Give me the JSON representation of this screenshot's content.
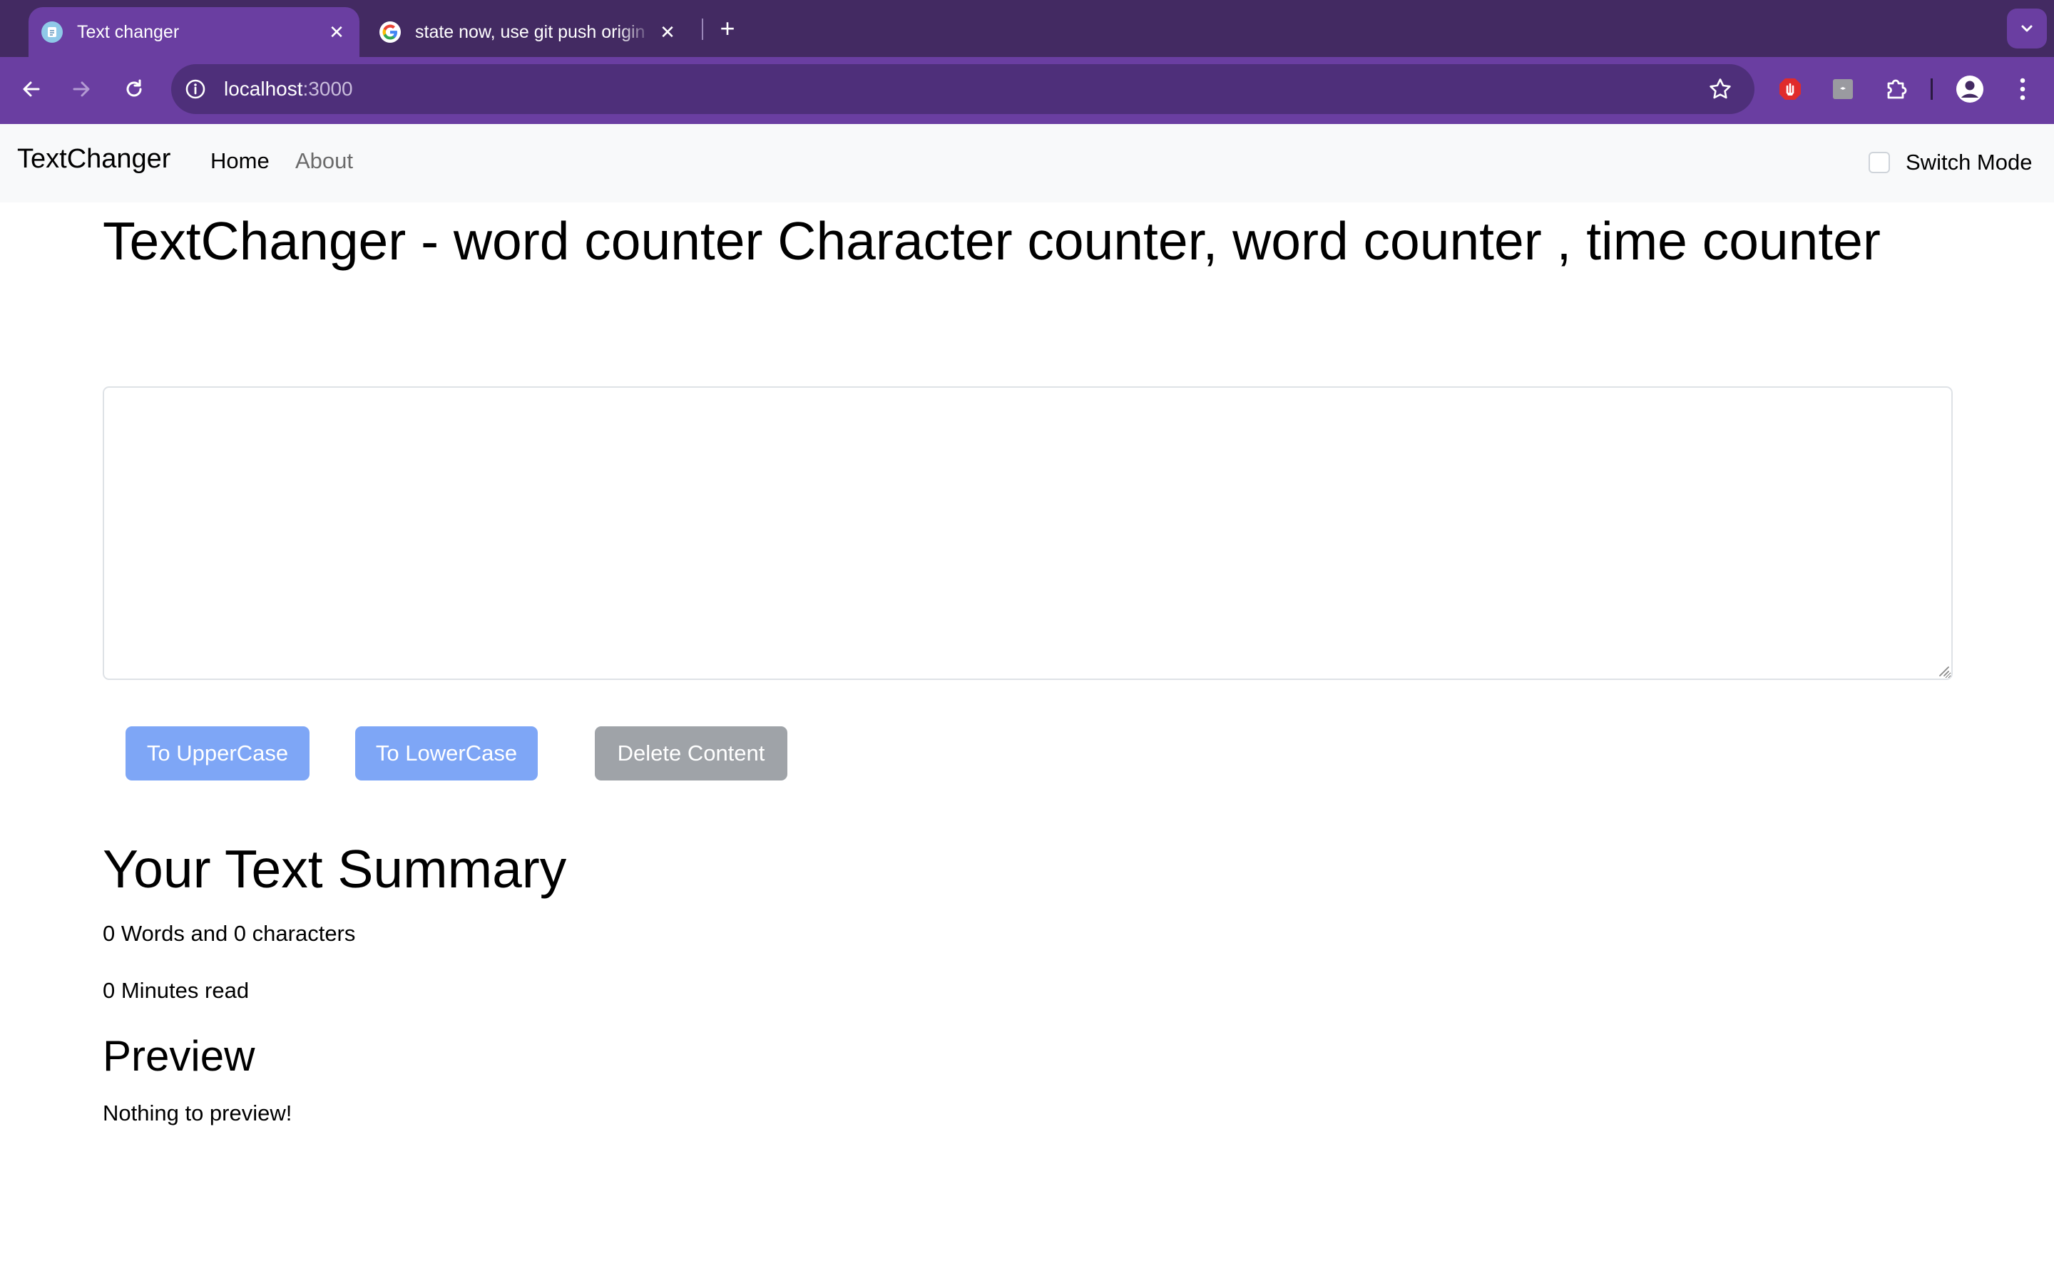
{
  "browser": {
    "tabs": [
      {
        "title": "Text changer",
        "active": true
      },
      {
        "title": "state now, use git push origin",
        "active": false
      }
    ],
    "url_host": "localhost",
    "url_port": ":3000"
  },
  "navbar": {
    "brand": "TextChanger",
    "links": [
      "Home",
      "About"
    ],
    "switch_label": "Switch Mode"
  },
  "main": {
    "title": "TextChanger - word counter Character counter, word counter , time counter",
    "textarea_value": "",
    "buttons": {
      "upper": "To UpperCase",
      "lower": "To LowerCase",
      "delete": "Delete Content"
    }
  },
  "summary": {
    "title": "Your Text Summary",
    "words_chars": "0 Words and 0 characters",
    "minutes": "0 Minutes read"
  },
  "preview": {
    "title": "Preview",
    "text": "Nothing to preview!"
  },
  "colors": {
    "tabstrip": "#432a62",
    "toolbar": "#6a3ea1",
    "primary_button": "#7ea6f6",
    "secondary_button": "#9fa3a8"
  }
}
